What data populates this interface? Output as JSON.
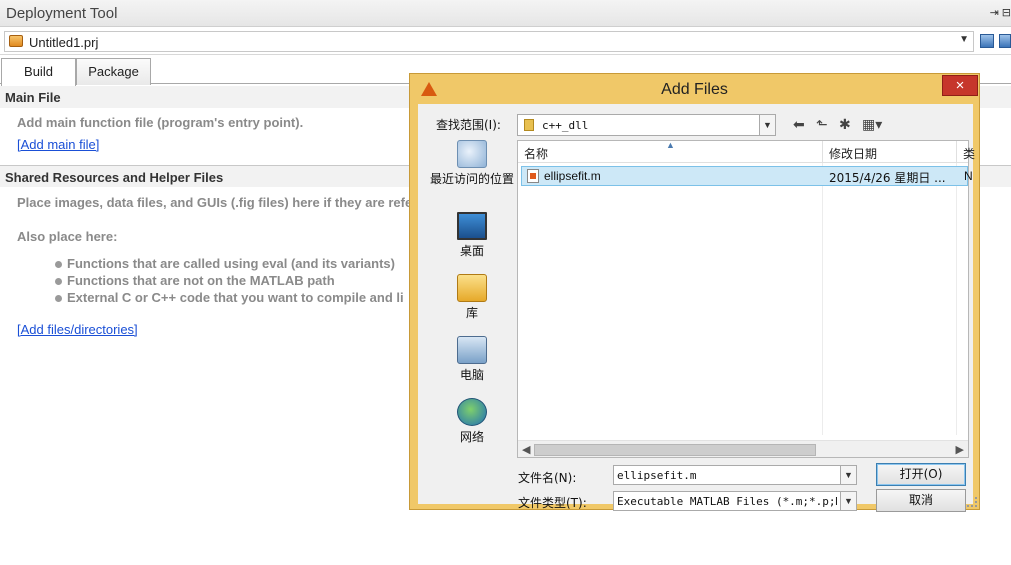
{
  "app": {
    "title": "Deployment Tool",
    "project": {
      "name": "Untitled1.prj"
    },
    "tabs": [
      {
        "label": "Build",
        "active": true
      },
      {
        "label": "Package",
        "active": false
      }
    ],
    "main_file": {
      "heading": "Main File",
      "hint": "Add main function file (program's entry point).",
      "link": "[Add main file]"
    },
    "shared": {
      "heading": "Shared Resources and Helper Files",
      "hint": "Place images, data files, and GUIs (.fig files) here if they are refe",
      "also": "Also place here:",
      "bullets": [
        "Functions that are called using eval (and its variants)",
        "Functions that are not on the MATLAB path",
        "External C or C++ code that you want to compile and li"
      ],
      "link": "[Add files/directories]"
    }
  },
  "dialog": {
    "title": "Add Files",
    "close_label": "×",
    "look_in_label": "查找范围(I):",
    "look_in_value": "c++_dll",
    "places": [
      {
        "label": "最近访问的位置",
        "icon": "recent-places-icon"
      },
      {
        "label": "桌面",
        "icon": "desktop-icon"
      },
      {
        "label": "库",
        "icon": "libraries-icon"
      },
      {
        "label": "电脑",
        "icon": "computer-icon"
      },
      {
        "label": "网络",
        "icon": "network-icon"
      }
    ],
    "columns": {
      "name": "名称",
      "date": "修改日期",
      "type": "类"
    },
    "files": [
      {
        "name": "ellipsefit.m",
        "date": "2015/4/26 星期日 ...",
        "type": "N",
        "selected": true
      }
    ],
    "filename_label": "文件名(N):",
    "filename_value": "ellipsefit.m",
    "filetype_label": "文件类型(T):",
    "filetype_value": "Executable MATLAB Files (*.m;*.p;MEX)",
    "open_label": "打开(O)",
    "cancel_label": "取消"
  }
}
